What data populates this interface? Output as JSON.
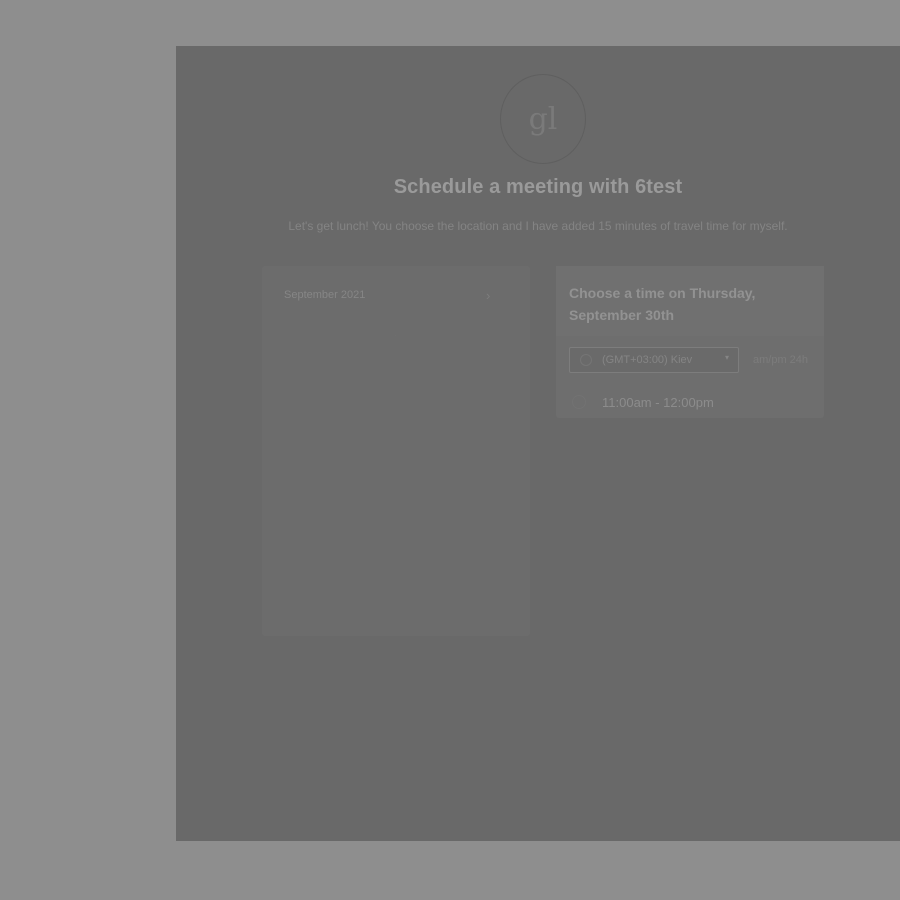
{
  "header": {
    "logo_text": "gl",
    "title": "Schedule a meeting with 6test",
    "description": "Let's get lunch! You choose the location and I have added 15 minutes of travel time for myself."
  },
  "calendar": {
    "month_label": "September 2021",
    "next_icon": "chevron-right-icon",
    "marker": "·"
  },
  "times": {
    "heading": "Choose a time on Thursday, September 30th",
    "timezone": {
      "value": "(GMT+03:00) Kiev",
      "icon": "globe-icon",
      "arrow": "▾"
    },
    "format_toggle": "am/pm  24h",
    "slots": [
      {
        "label": "11:00am - 12:00pm"
      }
    ]
  },
  "colors": {
    "backdrop": "#8e8e8e",
    "panel": "#696969"
  }
}
